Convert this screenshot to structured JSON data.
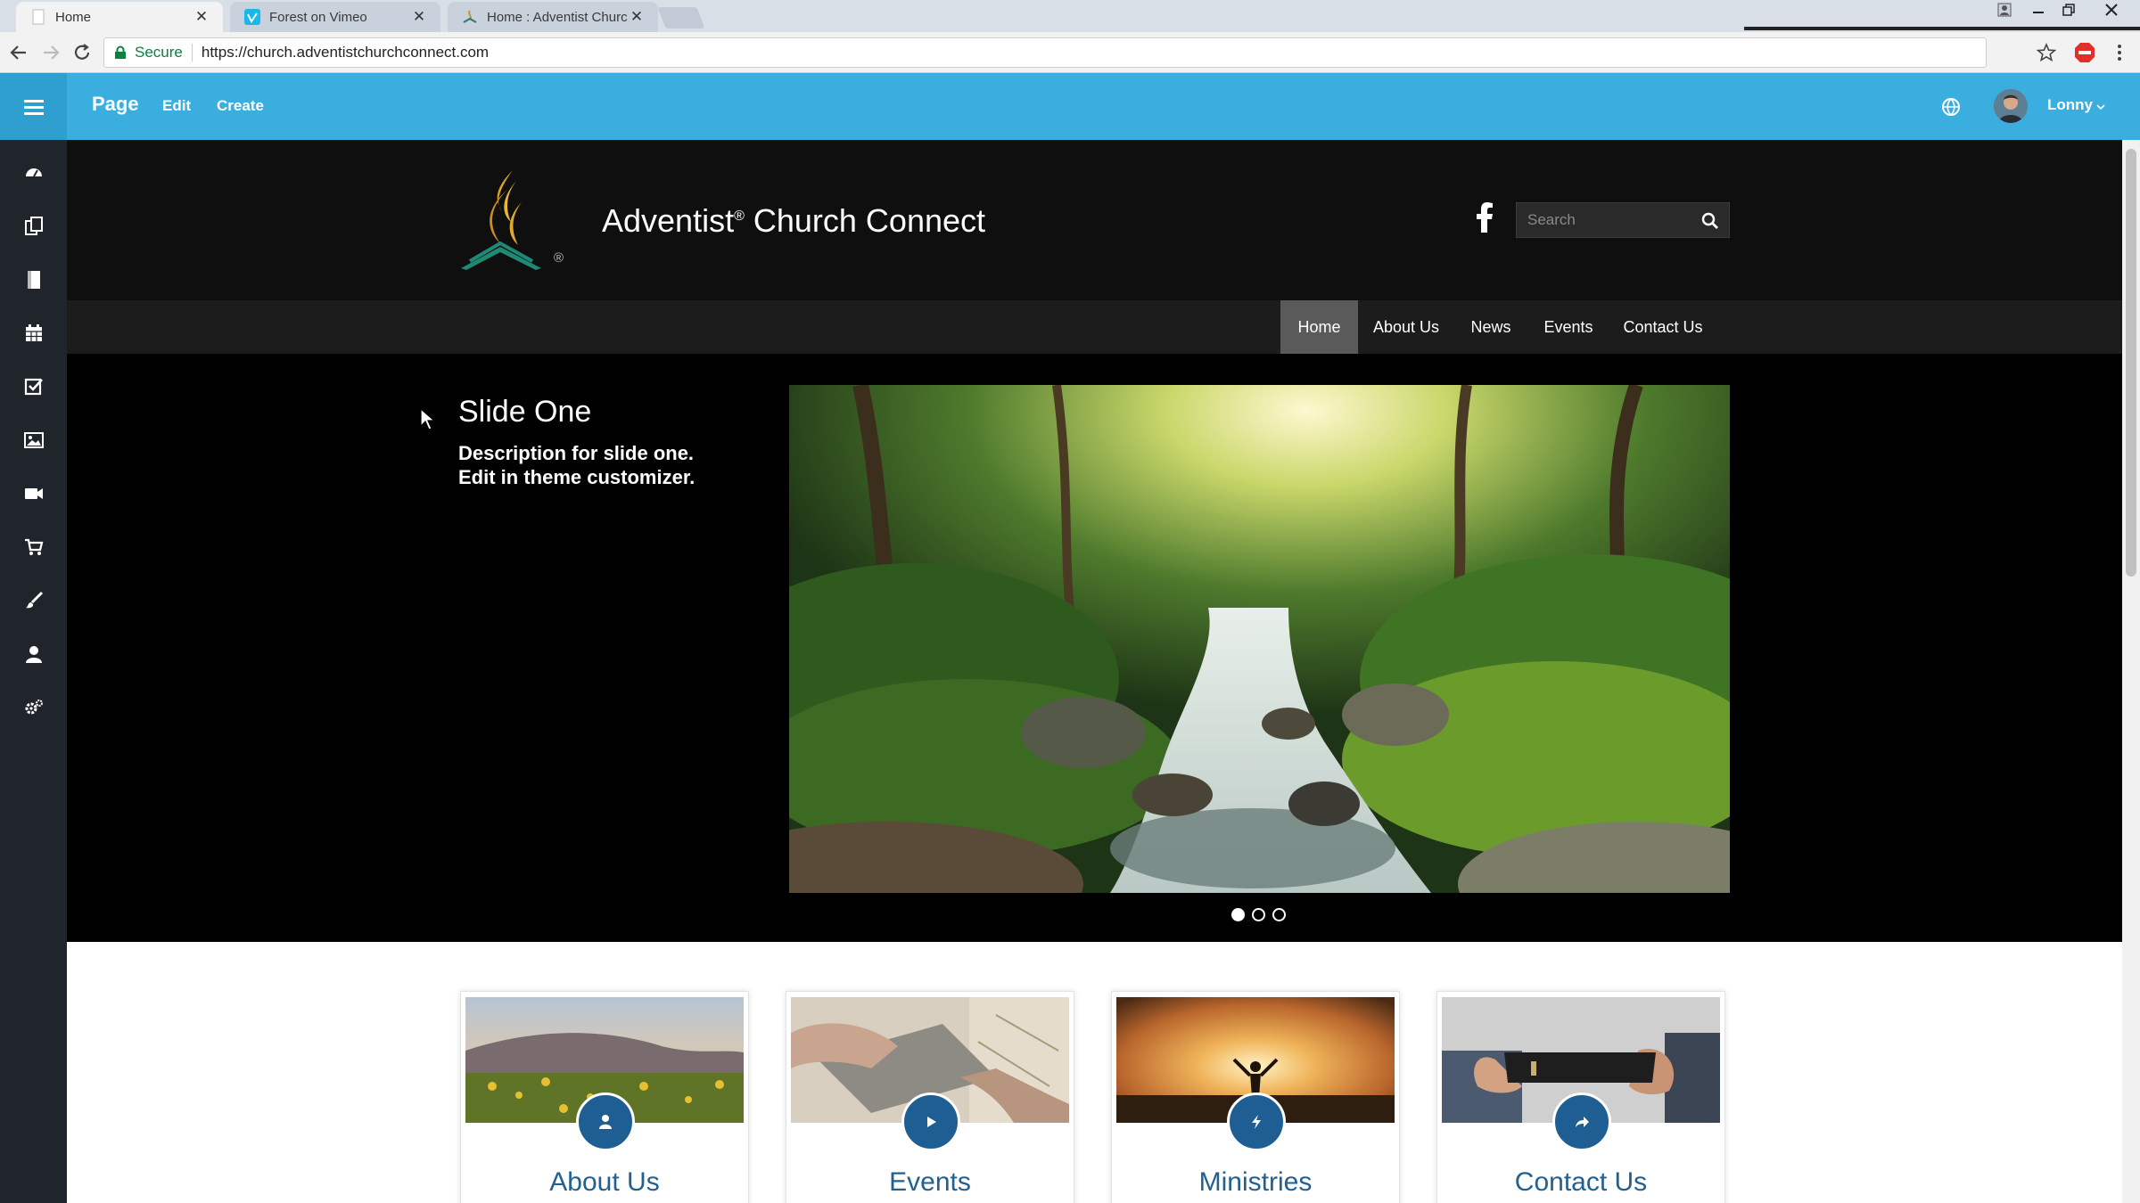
{
  "browser": {
    "tabs": [
      {
        "title": "Home",
        "active": true
      },
      {
        "title": "Forest on Vimeo",
        "active": false
      },
      {
        "title": "Home : Adventist Church Connect",
        "active": false
      }
    ],
    "secure_label": "Secure",
    "url": "https://church.adventistchurchconnect.com"
  },
  "admin_bar": {
    "title": "Page",
    "edit_label": "Edit",
    "create_label": "Create",
    "username": "Lonny",
    "color": "#3aaede"
  },
  "sidebar": {
    "icons": [
      "dashboard-icon",
      "pages-icon",
      "document-icon",
      "calendar-icon",
      "checklist-icon",
      "image-icon",
      "video-icon",
      "cart-icon",
      "brush-icon",
      "user-icon",
      "settings-icon"
    ]
  },
  "site": {
    "name": "Adventist",
    "name_mark": "®",
    "name_rest": " Church Connect",
    "logo_mark": "®",
    "search_placeholder": "Search",
    "nav": [
      {
        "label": "Home",
        "active": true
      },
      {
        "label": "About Us",
        "active": false
      },
      {
        "label": "News",
        "active": false
      },
      {
        "label": "Events",
        "active": false
      },
      {
        "label": "Contact Us",
        "active": false
      }
    ],
    "slide": {
      "title": "Slide One",
      "description": "Description for slide one. Edit in theme customizer.",
      "active_index": 1,
      "count": 3
    },
    "cards": [
      {
        "title": "About Us",
        "icon": "user-icon"
      },
      {
        "title": "Events",
        "icon": "play-icon"
      },
      {
        "title": "Ministries",
        "icon": "bolt-icon"
      },
      {
        "title": "Contact Us",
        "icon": "share-icon"
      }
    ],
    "accent_color": "#1f5e93"
  }
}
